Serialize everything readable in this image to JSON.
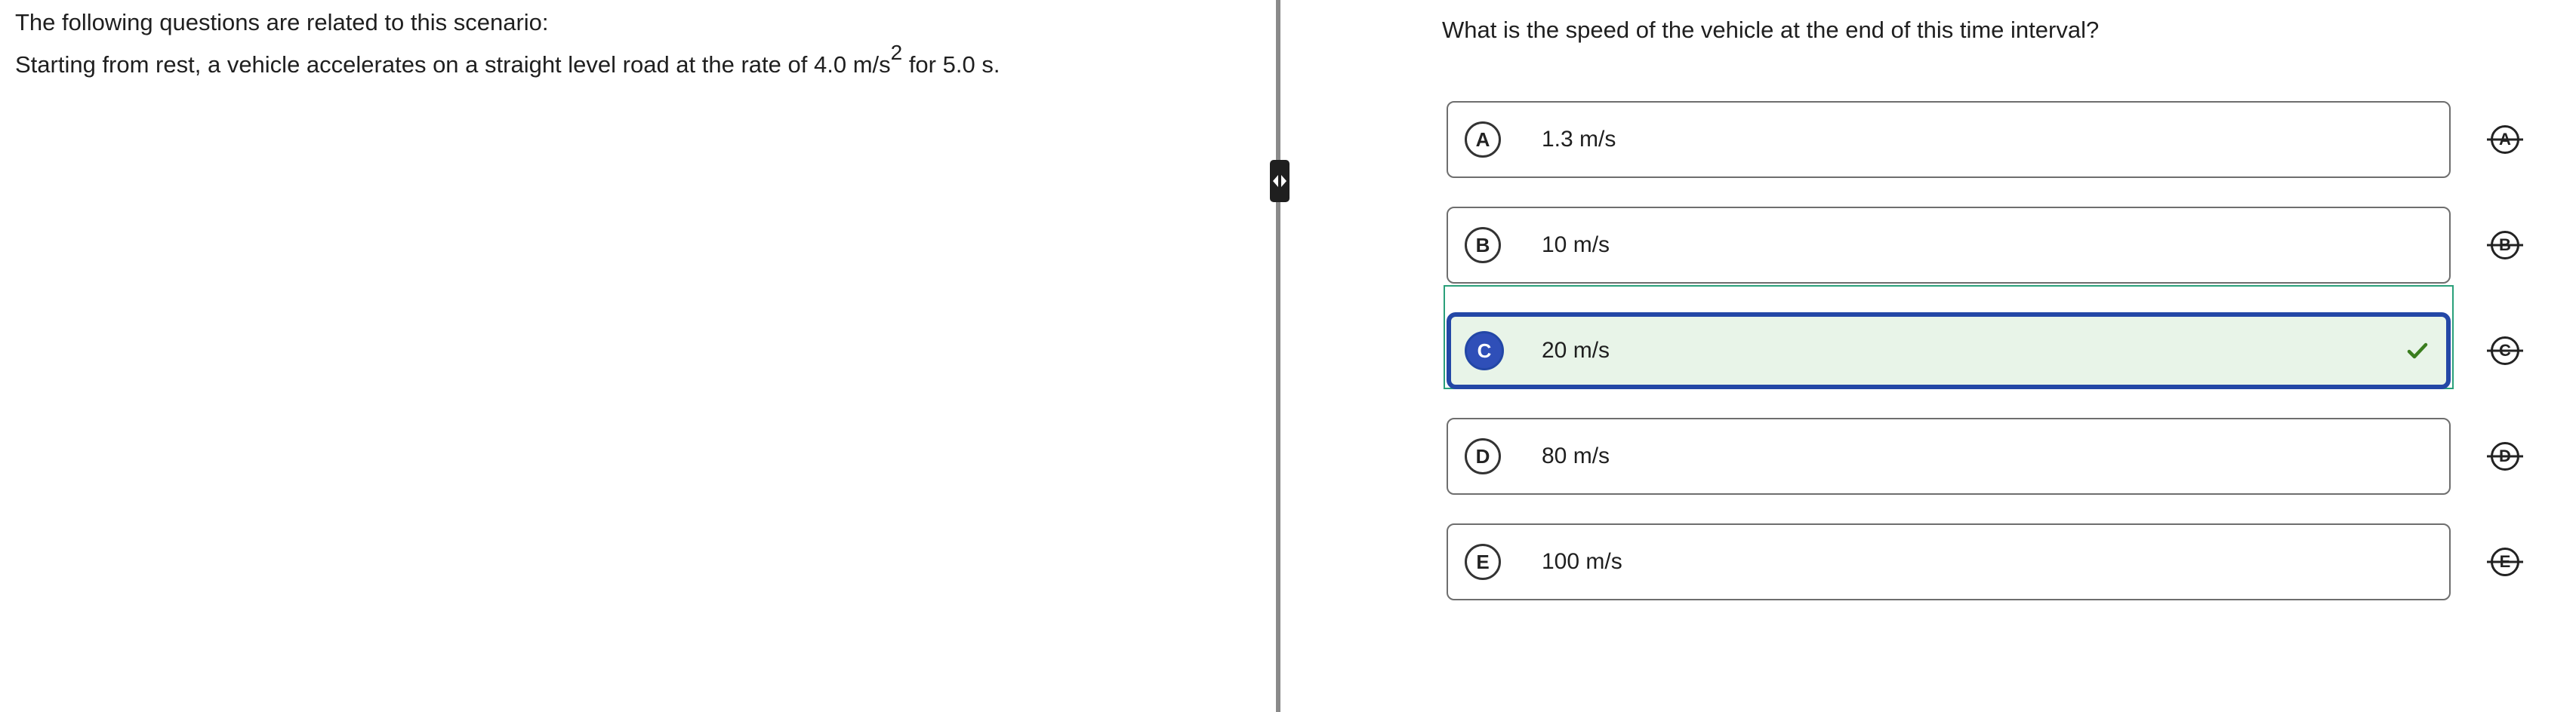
{
  "passage": {
    "intro": "The following questions are related to this scenario:",
    "scenario_pre": "Starting from rest, a vehicle accelerates on a straight level road at the rate of 4.0 m/s",
    "scenario_sup": "2",
    "scenario_post": " for 5.0 s."
  },
  "question": {
    "stem": "What is the speed of the vehicle at the end of this time interval?",
    "options": [
      {
        "letter": "A",
        "text": "1.3 m/s",
        "selected": false
      },
      {
        "letter": "B",
        "text": "10 m/s",
        "selected": false
      },
      {
        "letter": "C",
        "text": "20 m/s",
        "selected": true
      },
      {
        "letter": "D",
        "text": "80 m/s",
        "selected": false
      },
      {
        "letter": "E",
        "text": "100 m/s",
        "selected": false
      }
    ]
  },
  "icons": {
    "divider_handle": "resize-arrows-icon",
    "selected_mark": "checkmark-icon",
    "strikeout": "strikeout-letter-icon"
  },
  "colors": {
    "selected_border": "#2347a6",
    "selected_fill": "#e8f4e8",
    "selected_letter_bg": "#2f4fb8",
    "check": "#3a7d1e",
    "outline_focus": "#2aa07a",
    "divider": "#8a8a8a"
  }
}
